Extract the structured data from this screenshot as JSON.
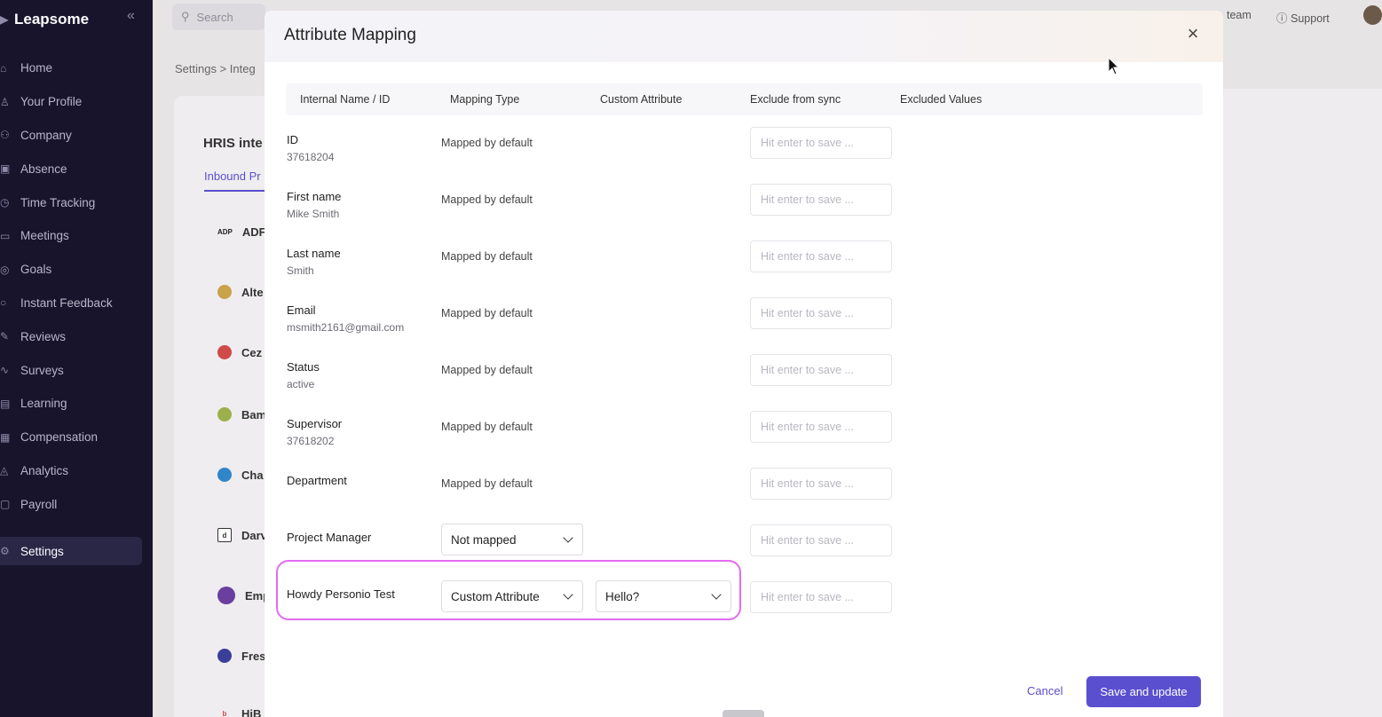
{
  "app": {
    "name": "Leapsome",
    "collapse_icon": "«"
  },
  "sidebar": {
    "items": [
      {
        "label": "Home",
        "icon": "home-icon"
      },
      {
        "label": "Your Profile",
        "icon": "user-icon"
      },
      {
        "label": "Company",
        "icon": "people-icon"
      },
      {
        "label": "Absence",
        "icon": "calendar-x-icon"
      },
      {
        "label": "Time Tracking",
        "icon": "clock-icon"
      },
      {
        "label": "Meetings",
        "icon": "calendar-icon"
      },
      {
        "label": "Goals",
        "icon": "target-icon"
      },
      {
        "label": "Instant Feedback",
        "icon": "chat-icon"
      },
      {
        "label": "Reviews",
        "icon": "pencil-icon"
      },
      {
        "label": "Surveys",
        "icon": "pulse-icon"
      },
      {
        "label": "Learning",
        "icon": "book-icon"
      },
      {
        "label": "Compensation",
        "icon": "coins-icon"
      },
      {
        "label": "Analytics",
        "icon": "chart-icon"
      },
      {
        "label": "Payroll",
        "icon": "money-icon"
      }
    ],
    "active": {
      "label": "Settings",
      "icon": "gear-icon"
    }
  },
  "topbar": {
    "search_placeholder": "Search",
    "team_label": "team",
    "support_label": "Support"
  },
  "background": {
    "breadcrumb": "Settings  >  Integ",
    "section_title": "HRIS inte",
    "tab": "Inbound Pr",
    "providers": [
      {
        "label": "ADF",
        "badge": "ADP"
      },
      {
        "label": "Alte",
        "badge": ""
      },
      {
        "label": "Cez",
        "badge": ""
      },
      {
        "label": "Bam",
        "badge": ""
      },
      {
        "label": "Cha",
        "badge": ""
      },
      {
        "label": "Darv",
        "badge": "d"
      },
      {
        "label": "Emp",
        "badge": ""
      },
      {
        "label": "Fres",
        "badge": ""
      },
      {
        "label": "HiB",
        "badge": ""
      }
    ]
  },
  "modal": {
    "title": "Attribute Mapping",
    "close_icon": "×",
    "columns": [
      "Internal Name / ID",
      "Mapping Type",
      "Custom Attribute",
      "Exclude from sync",
      "Excluded Values"
    ],
    "input_placeholder": "Hit enter to save ...",
    "rows": [
      {
        "name": "ID",
        "value": "37618204",
        "mapping": "Mapped by default"
      },
      {
        "name": "First name",
        "value": "Mike Smith",
        "mapping": "Mapped by default"
      },
      {
        "name": "Last name",
        "value": "Smith",
        "mapping": "Mapped by default"
      },
      {
        "name": "Email",
        "value": "msmith2161@gmail.com",
        "mapping": "Mapped by default"
      },
      {
        "name": "Status",
        "value": "active",
        "mapping": "Mapped by default"
      },
      {
        "name": "Supervisor",
        "value": "37618202",
        "mapping": "Mapped by default"
      },
      {
        "name": "Department",
        "value": "",
        "mapping": "Mapped by default"
      }
    ],
    "project_manager": {
      "name": "Project Manager",
      "mapping_select": "Not mapped"
    },
    "howdy": {
      "name": "Howdy Personio Test",
      "mapping_select": "Custom Attribute",
      "attribute_select": "Hello?"
    },
    "cancel_label": "Cancel",
    "save_label": "Save and update"
  },
  "colors": {
    "accent": "#5a4fcf",
    "highlight": "#e36cf1",
    "sidebar_bg": "#17142c"
  }
}
